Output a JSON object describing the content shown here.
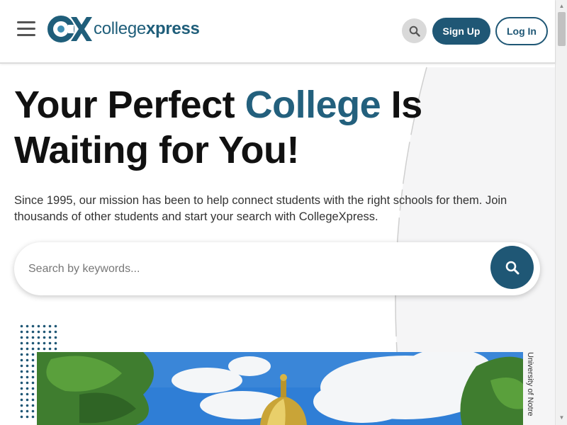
{
  "header": {
    "menu_icon": "hamburger-menu-icon",
    "logo": {
      "mark": "CX",
      "text_regular": "college",
      "text_bold": "xpress"
    },
    "search_icon": "search-icon",
    "signup_label": "Sign Up",
    "login_label": "Log In"
  },
  "hero": {
    "headline_part1": "Your Perfect ",
    "headline_accent": "College",
    "headline_part2": " Is Waiting for You!",
    "intro": "Since 1995, our mission has been to help connect students with the right schools for them. Join thousands of other students and start your search with CollegeXpress."
  },
  "search": {
    "placeholder": "Search by keywords...",
    "button_icon": "search-icon"
  },
  "feature_image": {
    "caption": "University of Notre"
  },
  "colors": {
    "brand": "#1f5775",
    "accent_text": "#23607d",
    "header_border": "#dcdcdc"
  }
}
